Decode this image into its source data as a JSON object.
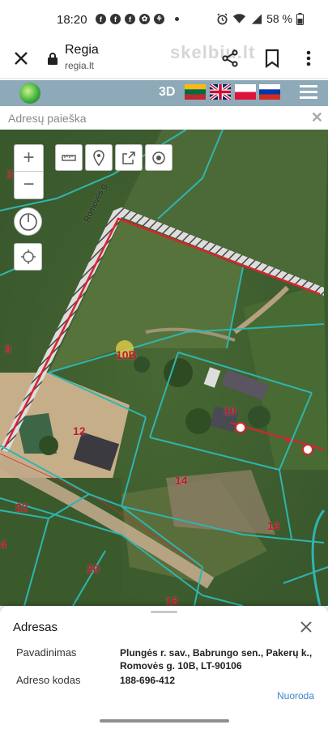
{
  "status": {
    "time": "18:20",
    "battery": "58 %",
    "icons": [
      "facebook-icon",
      "facebook-icon",
      "facebook-icon",
      "app-icon",
      "app-icon",
      "alarm-icon",
      "wifi-icon",
      "signal-icon",
      "battery-icon"
    ]
  },
  "browser": {
    "title": "Regia",
    "url": "regia.lt",
    "watermark": "skelbiu.lt"
  },
  "map_toolbar": {
    "mode_3d": "3D",
    "languages": [
      "lt",
      "en",
      "pl",
      "ru"
    ]
  },
  "search": {
    "placeholder": "Adresų paieška"
  },
  "map": {
    "street_label": "Romovės g.",
    "parcels": [
      {
        "label": "10B",
        "id": "10b"
      },
      {
        "label": "9",
        "id": "9"
      },
      {
        "label": "3",
        "id": "3"
      },
      {
        "label": "10",
        "id": "10"
      },
      {
        "label": "12",
        "id": "12"
      },
      {
        "label": "14",
        "id": "14"
      },
      {
        "label": "16",
        "id": "16"
      },
      {
        "label": "22",
        "id": "22"
      },
      {
        "label": "20",
        "id": "20"
      },
      {
        "label": "18",
        "id": "18"
      },
      {
        "label": "4",
        "id": "4"
      }
    ]
  },
  "colors": {
    "parcel_line": "#2fb5b0",
    "boundary": "#d9232e",
    "label": "#c2182b",
    "link": "#3f87c9",
    "map_header": "#8ea9b8"
  },
  "info": {
    "title": "Adresas",
    "name_label": "Pavadinimas",
    "name_value_line1": "Plungės r. sav., Babrungo sen., Pakerų k.,",
    "name_value_line2": "Romovės g. 10B, LT-90106",
    "code_label": "Adreso kodas",
    "code_value": "188-696-412",
    "link": "Nuoroda"
  }
}
